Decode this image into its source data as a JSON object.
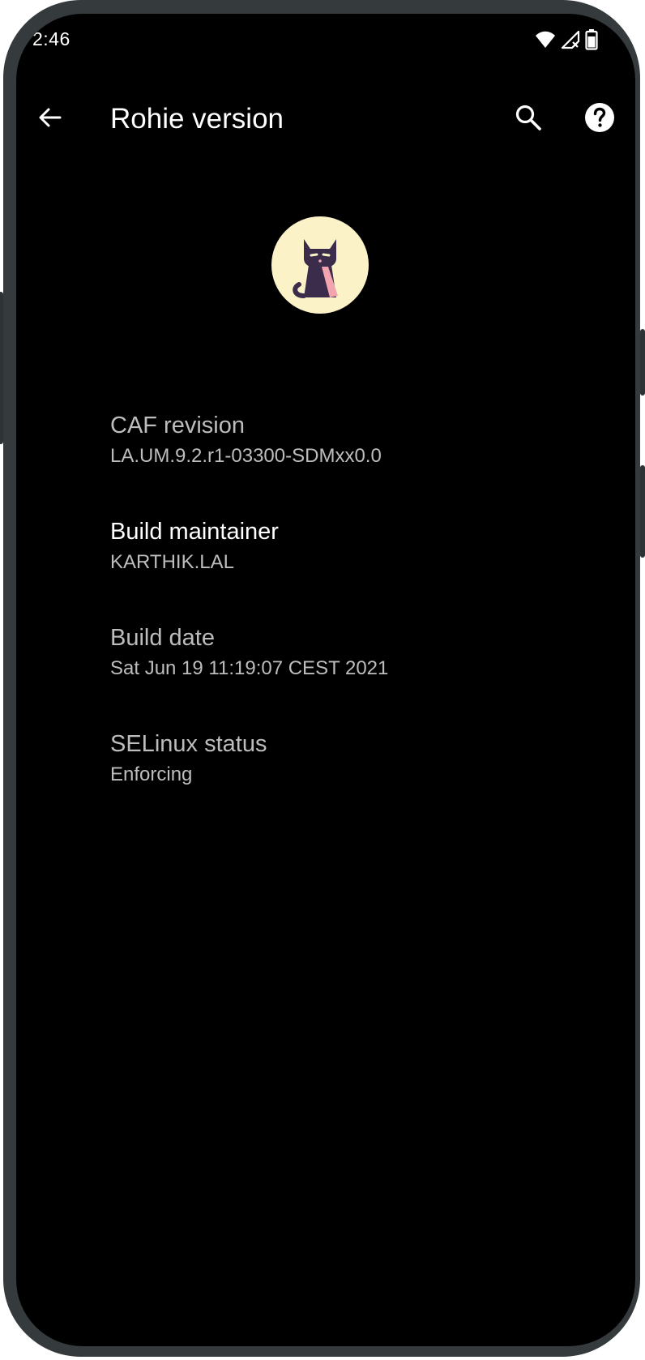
{
  "status_bar": {
    "time": "2:46",
    "icons": [
      "wifi-icon",
      "signal-no-service-icon",
      "battery-icon"
    ]
  },
  "app_bar": {
    "title": "Rohie version",
    "back_icon": "arrow-back-icon",
    "search_icon": "search-icon",
    "help_icon": "help-icon"
  },
  "logo": {
    "icon": "cat-logo-icon",
    "colors": {
      "background": "#fbf3c7",
      "cat": "#3a2c4a",
      "tie": "#f4a3b0"
    }
  },
  "preferences": [
    {
      "title": "CAF revision",
      "summary": "LA.UM.9.2.r1-03300-SDMxx0.0",
      "enabled": false
    },
    {
      "title": "Build maintainer",
      "summary": "KARTHIK.LAL",
      "enabled": true
    },
    {
      "title": "Build date",
      "summary": "Sat Jun 19 11:19:07 CEST 2021",
      "enabled": false
    },
    {
      "title": "SELinux status",
      "summary": "Enforcing",
      "enabled": false
    }
  ]
}
